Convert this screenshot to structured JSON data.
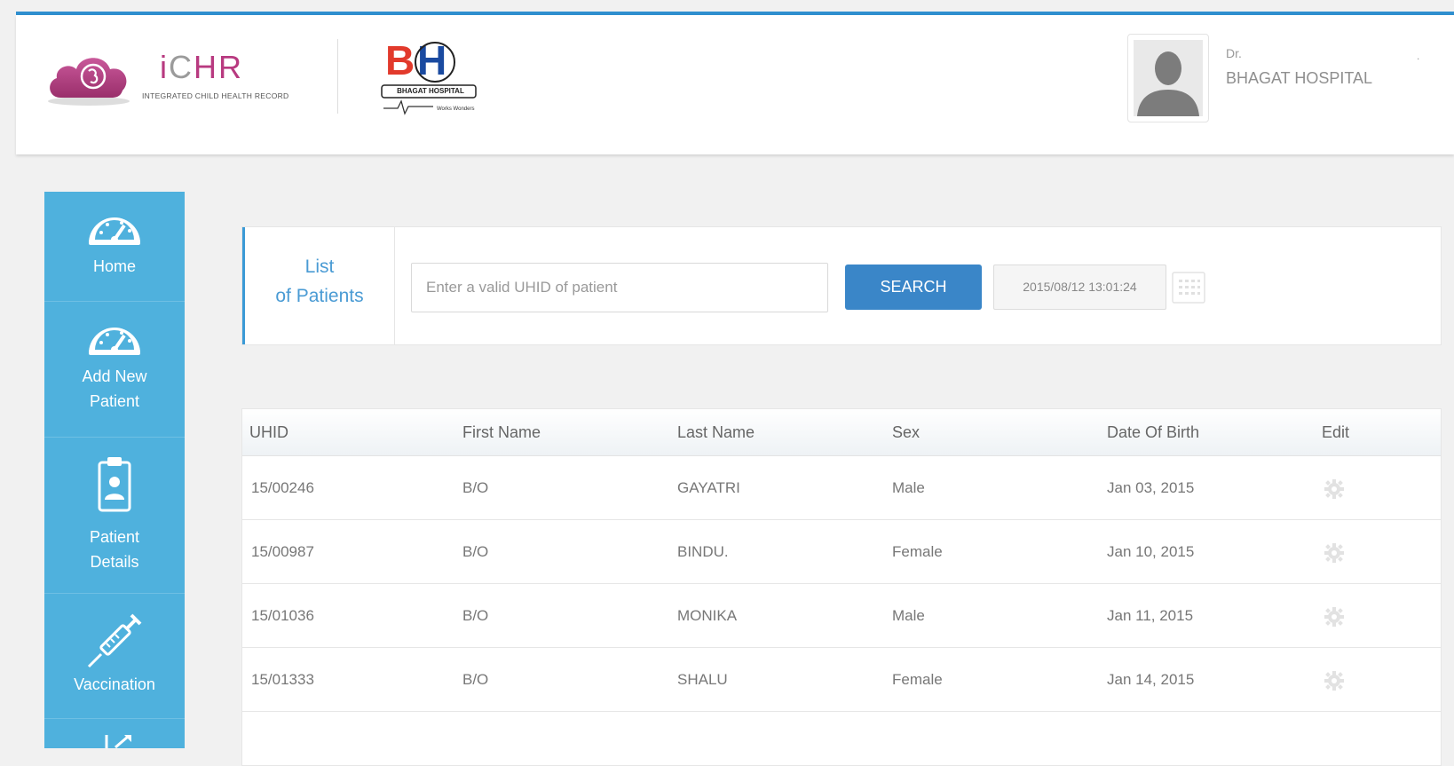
{
  "header": {
    "app_logo_word_prefix": "i",
    "app_logo_word_suffix": "HR",
    "app_logo_letter_c": "C",
    "app_subtitle": "INTEGRATED CHILD HEALTH RECORD",
    "hospital_logo_text": "BHAGAT HOSPITAL",
    "user_prefix": "Dr.",
    "user_hospital": "BHAGAT HOSPITAL",
    "user_dot": "."
  },
  "sidebar": {
    "items": [
      {
        "label": "Home",
        "icon": "dashboard-gauge-icon"
      },
      {
        "label": "Add New Patient",
        "label_line1": "Add New",
        "label_line2": "Patient",
        "icon": "dashboard-gauge-icon"
      },
      {
        "label": "Patient Details",
        "label_line1": "Patient",
        "label_line2": "Details",
        "icon": "clipboard-user-icon"
      },
      {
        "label": "Vaccination",
        "icon": "syringe-icon"
      },
      {
        "label": "",
        "icon": "growth-chart-icon"
      }
    ]
  },
  "list_panel": {
    "title_line1": "List",
    "title_line2": "of Patients",
    "search_placeholder": "Enter a valid UHID of patient",
    "search_value": "",
    "search_button": "SEARCH",
    "datetime": "2015/08/12 13:01:24",
    "calendar_icon": "calendar-icon"
  },
  "table": {
    "columns": [
      "UHID",
      "First Name",
      "Last Name",
      "Sex",
      "Date Of Birth",
      "Edit"
    ],
    "rows": [
      {
        "uhid": "15/00246",
        "first": "B/O",
        "last": "GAYATRI",
        "sex": "Male",
        "dob": "Jan 03, 2015"
      },
      {
        "uhid": "15/00987",
        "first": "B/O",
        "last": "BINDU.",
        "sex": "Female",
        "dob": "Jan 10, 2015"
      },
      {
        "uhid": "15/01036",
        "first": "B/O",
        "last": "MONIKA",
        "sex": "Male",
        "dob": "Jan 11, 2015"
      },
      {
        "uhid": "15/01333",
        "first": "B/O",
        "last": "SHALU",
        "sex": "Female",
        "dob": "Jan 14, 2015"
      }
    ],
    "edit_icon": "gear-icon"
  },
  "colors": {
    "accent_blue": "#3a86c8",
    "sidebar_blue": "#4fb1dd",
    "brand_pink": "#b83a80",
    "top_line": "#2f8fcf"
  }
}
